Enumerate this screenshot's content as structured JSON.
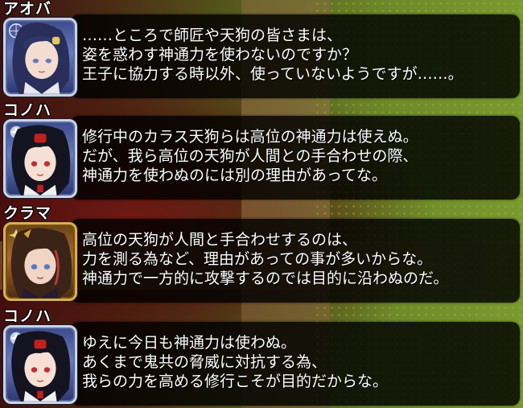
{
  "dialogue": [
    {
      "speaker": "アオバ",
      "frame": "silver",
      "lines": [
        "……ところで師匠や天狗の皆さまは、",
        "姿を惑わす神通力を使わないのですか？",
        "王子に協力する時以外、使っていないようですが……。"
      ]
    },
    {
      "speaker": "コノハ",
      "frame": "silver",
      "lines": [
        "修行中のカラス天狗らは高位の神通力は使えぬ。",
        "だが、我ら高位の天狗が人間との手合わせの際、",
        "神通力を使わぬのには別の理由があってな。"
      ]
    },
    {
      "speaker": "クラマ",
      "frame": "gold",
      "lines": [
        "高位の天狗が人間と手合わせするのは、",
        "力を測る為など、理由があっての事が多いからな。",
        "神通力で一方的に攻撃するのでは目的に沿わぬのだ。"
      ]
    },
    {
      "speaker": "コノハ",
      "frame": "silver",
      "lines": [
        "ゆえに今日も神通力は使わぬ。",
        "あくまで鬼共の脅威に対抗する為、",
        "我らの力を高める修行こそが目的だからな。"
      ]
    }
  ]
}
